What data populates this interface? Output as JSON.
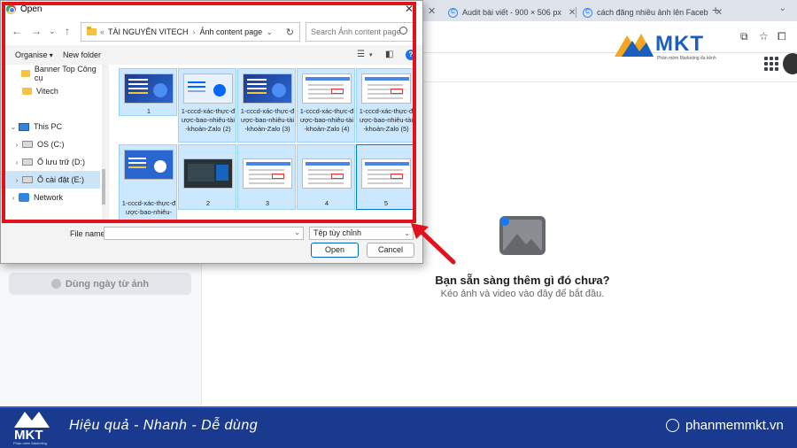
{
  "browser": {
    "tabs": [
      {
        "label": "Audit bài viết - 900 × 506 px"
      },
      {
        "label": "cách đăng nhiều ảnh lên Faceb"
      }
    ]
  },
  "logo": {
    "brand": "MKT",
    "tagline": "Phần mềm Marketing đa kênh"
  },
  "background_page": {
    "use_photo_button": "Dùng ngày từ ảnh",
    "empty_title": "Bạn sẵn sàng thêm gì đó chưa?",
    "empty_subtitle": "Kéo ảnh và video vào đây để bắt đầu."
  },
  "footer": {
    "brand": "MKT",
    "brand_sub": "Phần mềm Marketing",
    "slogan": "Hiệu quả - Nhanh  - Dễ dùng",
    "website": "phanmemmkt.vn"
  },
  "dialog": {
    "title": "Open",
    "breadcrumb": [
      "TÀI NGUYÊN VITECH",
      "Ảnh content page"
    ],
    "search_placeholder": "Search Ảnh content page",
    "organise": "Organise",
    "new_folder": "New folder",
    "nav_items": [
      {
        "label": "Banner Top Công cụ",
        "icon": "folder-icon"
      },
      {
        "label": "Vitech",
        "icon": "folder-icon"
      },
      {
        "label": "This PC",
        "icon": "pc-icon"
      },
      {
        "label": "OS (C:)",
        "icon": "drive-icon"
      },
      {
        "label": "Ổ lưu trữ (D:)",
        "icon": "drive-icon"
      },
      {
        "label": "Ổ cài đặt (E:)",
        "icon": "drive-icon"
      },
      {
        "label": "Network",
        "icon": "network-icon"
      }
    ],
    "files": [
      {
        "label": "1"
      },
      {
        "label": "1-cccd-xác-thực-được-bao-nhiêu-tài-khoản-Zalo (2)"
      },
      {
        "label": "1-cccd-xác-thực-được-bao-nhiêu-tài-khoản-Zalo (3)"
      },
      {
        "label": "1-cccd-xác-thực-được-bao-nhiêu-tài-khoản-Zalo (4)"
      },
      {
        "label": "1-cccd-xác-thực-được-bao-nhiêu-tài-khoản-Zalo (5)"
      },
      {
        "label": "1-cccd-xác-thực-được-bao-nhiêu-"
      },
      {
        "label": "2"
      },
      {
        "label": "3"
      },
      {
        "label": "4"
      },
      {
        "label": "5"
      }
    ],
    "file_name_label": "File name:",
    "file_name_value": "",
    "file_type": "Tệp tùy chỉnh",
    "open_button": "Open",
    "cancel_button": "Cancel"
  },
  "colors": {
    "highlight_frame": "#e0121b",
    "footer_bg": "#1a3a8f",
    "selection": "#cce8ff",
    "brand_blue": "#1a5fbf"
  }
}
